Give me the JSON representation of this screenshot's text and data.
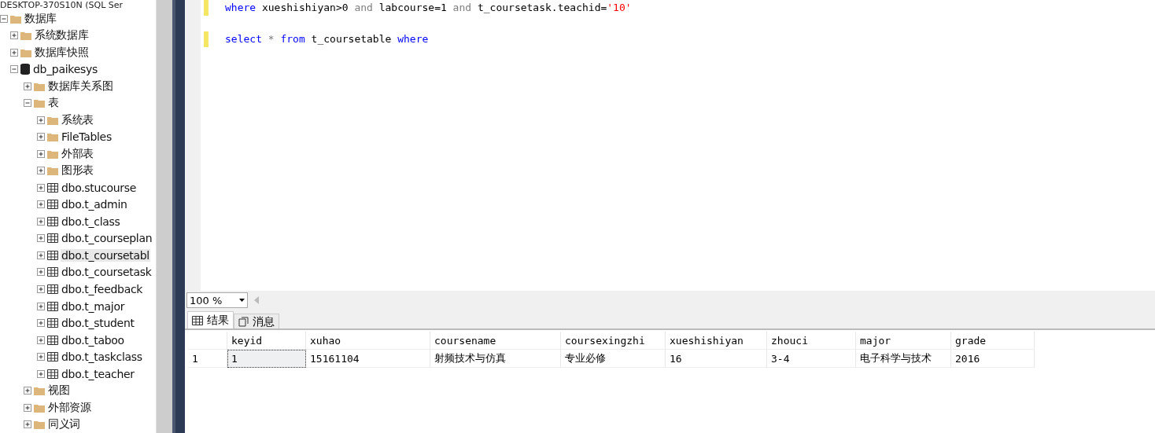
{
  "server": {
    "label": "DESKTOP-370S10N (SQL Ser"
  },
  "tree": [
    {
      "label": "数据库",
      "kind": "folder",
      "expanded": true,
      "selected": false,
      "children": [
        {
          "label": "系统数据库",
          "kind": "folder",
          "expanded": false,
          "selected": false
        },
        {
          "label": "数据库快照",
          "kind": "folder",
          "expanded": false,
          "selected": false
        },
        {
          "label": "db_paikesys",
          "kind": "database",
          "expanded": true,
          "selected": false,
          "children": [
            {
              "label": "数据库关系图",
              "kind": "folder",
              "expanded": false,
              "selected": false
            },
            {
              "label": "表",
              "kind": "folder",
              "expanded": true,
              "selected": false,
              "children": [
                {
                  "label": "系统表",
                  "kind": "folder",
                  "expanded": false,
                  "selected": false
                },
                {
                  "label": "FileTables",
                  "kind": "folder",
                  "expanded": false,
                  "selected": false
                },
                {
                  "label": "外部表",
                  "kind": "folder",
                  "expanded": false,
                  "selected": false
                },
                {
                  "label": "图形表",
                  "kind": "folder",
                  "expanded": false,
                  "selected": false
                },
                {
                  "label": "dbo.stucourse",
                  "kind": "table",
                  "expanded": false,
                  "selected": false
                },
                {
                  "label": "dbo.t_admin",
                  "kind": "table",
                  "expanded": false,
                  "selected": false
                },
                {
                  "label": "dbo.t_class",
                  "kind": "table",
                  "expanded": false,
                  "selected": false
                },
                {
                  "label": "dbo.t_courseplan",
                  "kind": "table",
                  "expanded": false,
                  "selected": false
                },
                {
                  "label": "dbo.t_coursetabl",
                  "kind": "table",
                  "expanded": false,
                  "selected": true
                },
                {
                  "label": "dbo.t_coursetask",
                  "kind": "table",
                  "expanded": false,
                  "selected": false
                },
                {
                  "label": "dbo.t_feedback",
                  "kind": "table",
                  "expanded": false,
                  "selected": false
                },
                {
                  "label": "dbo.t_major",
                  "kind": "table",
                  "expanded": false,
                  "selected": false
                },
                {
                  "label": "dbo.t_student",
                  "kind": "table",
                  "expanded": false,
                  "selected": false
                },
                {
                  "label": "dbo.t_taboo",
                  "kind": "table",
                  "expanded": false,
                  "selected": false
                },
                {
                  "label": "dbo.t_taskclass",
                  "kind": "table",
                  "expanded": false,
                  "selected": false
                },
                {
                  "label": "dbo.t_teacher",
                  "kind": "table",
                  "expanded": false,
                  "selected": false
                }
              ]
            },
            {
              "label": "视图",
              "kind": "folder",
              "expanded": false,
              "selected": false
            },
            {
              "label": "外部资源",
              "kind": "folder",
              "expanded": false,
              "selected": false
            },
            {
              "label": "同义词",
              "kind": "folder",
              "expanded": false,
              "selected": false
            }
          ]
        }
      ]
    }
  ],
  "editor": {
    "lines": [
      {
        "tokens": [
          {
            "t": "where",
            "kind": "keyword"
          },
          {
            "t": " xueshishiyan>0 ",
            "kind": "name"
          },
          {
            "t": "and",
            "kind": "operator"
          },
          {
            "t": " labcourse=1 ",
            "kind": "name"
          },
          {
            "t": "and",
            "kind": "operator"
          },
          {
            "t": " t_coursetask.teachid=",
            "kind": "name"
          },
          {
            "t": "'10'",
            "kind": "string"
          }
        ]
      },
      {
        "tokens": [
          {
            "t": "select",
            "kind": "keyword"
          },
          {
            "t": " * ",
            "kind": "operator"
          },
          {
            "t": "from",
            "kind": "keyword"
          },
          {
            "t": " t_coursetable ",
            "kind": "name"
          },
          {
            "t": "where",
            "kind": "keyword"
          }
        ]
      }
    ]
  },
  "zoom": {
    "value": "100 %"
  },
  "result_tabs": [
    {
      "label": "结果",
      "selected": true
    },
    {
      "label": "消息",
      "selected": false
    }
  ],
  "table": {
    "columns": [
      "keyid",
      "xuhao",
      "coursename",
      "coursexingzhi",
      "xueshishiyan",
      "zhouci",
      "major",
      "grade"
    ],
    "rows": [
      {
        "number": "1",
        "cells": [
          {
            "text": "1",
            "focused": true
          },
          {
            "text": "15161104",
            "focused": false
          },
          {
            "text": "射频技术与仿真",
            "focused": false
          },
          {
            "text": "专业必修",
            "focused": false
          },
          {
            "text": "16",
            "focused": false
          },
          {
            "text": "3-4",
            "focused": false
          },
          {
            "text": "电子科学与技术",
            "focused": false
          },
          {
            "text": "2016",
            "focused": false
          }
        ]
      }
    ]
  }
}
